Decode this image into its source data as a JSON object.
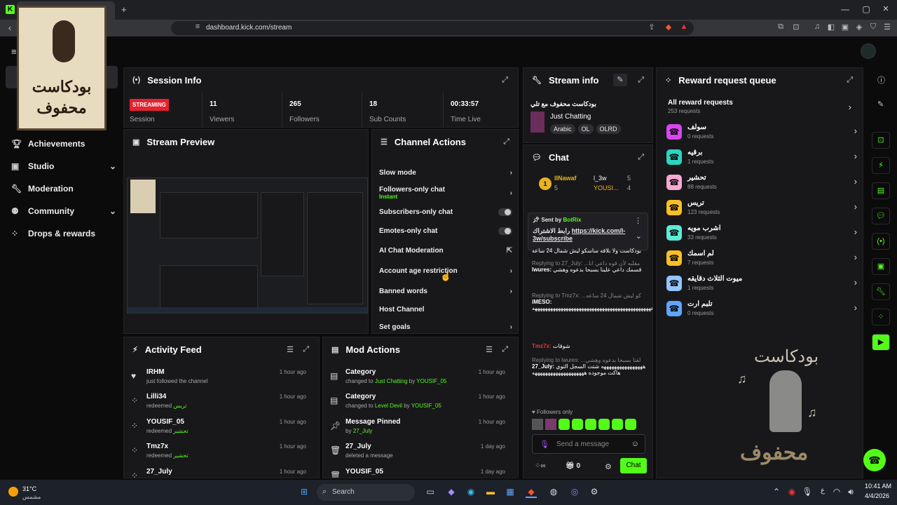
{
  "browser": {
    "url": "dashboard.kick.com/stream",
    "tab_close": "×",
    "tab_add": "+"
  },
  "logo": {
    "line1": "بودكاست",
    "line2": "محفوف"
  },
  "nav": [
    {
      "label": "Achievements",
      "icon": "trophy-icon"
    },
    {
      "label": "Studio",
      "icon": "studio-icon"
    },
    {
      "label": "Moderation",
      "icon": "wrench-icon"
    },
    {
      "label": "Community",
      "icon": "community-icon"
    },
    {
      "label": "Drops & rewards",
      "icon": "drops-icon"
    }
  ],
  "session": {
    "title": "Session Info",
    "stats": [
      {
        "value": "STREAMING",
        "label": "Session"
      },
      {
        "value": "11",
        "label": "Viewers"
      },
      {
        "value": "265",
        "label": "Followers"
      },
      {
        "value": "18",
        "label": "Sub Counts"
      },
      {
        "value": "00:33:57",
        "label": "Time Live"
      }
    ]
  },
  "preview": {
    "title": "Stream Preview"
  },
  "channel_actions": {
    "title": "Channel Actions",
    "items": [
      {
        "label": "Slow mode",
        "sub": ""
      },
      {
        "label": "Followers-only chat",
        "sub": "Instant"
      },
      {
        "label": "Subscribers-only chat",
        "sub": ""
      },
      {
        "label": "Emotes-only chat",
        "sub": ""
      },
      {
        "label": "AI Chat Moderation",
        "sub": ""
      },
      {
        "label": "Account age restriction",
        "sub": ""
      },
      {
        "label": "Banned words",
        "sub": ""
      },
      {
        "label": "Host Channel",
        "sub": ""
      },
      {
        "label": "Set goals",
        "sub": ""
      }
    ]
  },
  "stream_info": {
    "title": "Stream info",
    "name": "بودكاست محفوف مع تلي",
    "category": "Just Chatting",
    "tags": [
      "Arabic",
      "OL",
      "OLRD"
    ]
  },
  "chat": {
    "title": "Chat",
    "top": [
      {
        "name": "llNawaf",
        "count": "5",
        "rank": "1"
      },
      {
        "name": "l_3w",
        "count": "5"
      },
      {
        "name": "YOUSI...",
        "count": "4"
      }
    ],
    "pinned_by_label": "Sent by",
    "pinned_by": "BotRix",
    "pinned_text": "رابط الاشتراك",
    "pinned_link": "https://kick.com/l-3w/subscribe",
    "lines": [
      {
        "reply": "",
        "user": "",
        "text": "بودكاست ولا بلاقه ساسكو ليش شمال 24 ساعه"
      },
      {
        "reply": "Replying to 27_July: ...مقلبه لأن قوه داعي انا",
        "user": "lwures:",
        "text": "قسمك داعي علينا بسبحا بدعوه وهشي"
      },
      {
        "reply": "Replying to Tmz7x: ...كو ليش شمال 24 ساعه",
        "user": "iMESO:",
        "text": "ههههههههههههههههههههههههههههههههههههههههههههههه"
      },
      {
        "reply": "",
        "user": "Tmz7x:",
        "text": "شوقات"
      },
      {
        "reply": "Replying to lwures: ...لقتا بسبحا بدعوه وهشي",
        "user": "27_July:",
        "text": "ههههههههههههههههه شتت السجل الثوي هاكت موجوده ههههههههههههههههههههه"
      }
    ],
    "followers_only": "Followers only",
    "placeholder": "Send a message",
    "footer_count": "0",
    "send_label": "Chat"
  },
  "reward_queue": {
    "title": "Reward request queue",
    "all_label": "All reward requests",
    "all_count": "253 requests",
    "items": [
      {
        "name": "سولف",
        "count": "0 requests",
        "color": "#d946ef"
      },
      {
        "name": "برقيه",
        "count": "1 requests",
        "color": "#2dd4bf"
      },
      {
        "name": "تحشير",
        "count": "88 requests",
        "color": "#f9a8d4"
      },
      {
        "name": "تريس",
        "count": "123 requests",
        "color": "#fbbf24"
      },
      {
        "name": "اشرب مويه",
        "count": "33 requests",
        "color": "#5eead4"
      },
      {
        "name": "لم اسمك",
        "count": "7 requests",
        "color": "#fbbf24"
      },
      {
        "name": "ميوت الثلاث دقايقه",
        "count": "1 requests",
        "color": "#93c5fd"
      },
      {
        "name": "تلبم ارت",
        "count": "0 requests",
        "color": "#60a5fa"
      }
    ]
  },
  "activity": {
    "title": "Activity Feed",
    "rows": [
      {
        "name": "IRHM",
        "desc": "just followed the channel",
        "item": "",
        "time": "1 hour ago",
        "icon": "heart-icon"
      },
      {
        "name": "Lilli34",
        "desc": "redeemed",
        "item": "تريس",
        "time": "1 hour ago",
        "icon": "drops-icon"
      },
      {
        "name": "YOUSIF_05",
        "desc": "redeemed",
        "item": "تحشير",
        "time": "1 hour ago",
        "icon": "drops-icon"
      },
      {
        "name": "Tmz7x",
        "desc": "redeemed",
        "item": "تحشير",
        "time": "1 hour ago",
        "icon": "drops-icon"
      },
      {
        "name": "27_July",
        "desc": "",
        "item": "",
        "time": "1 hour ago",
        "icon": "drops-icon"
      }
    ]
  },
  "mod": {
    "title": "Mod Actions",
    "rows": [
      {
        "name": "Category",
        "pre": "changed to",
        "item": "Just Chatting",
        "by": "YOUSIF_05",
        "time": "1 hour ago",
        "icon": "category-icon"
      },
      {
        "name": "Category",
        "pre": "changed to",
        "item": "Level Devil",
        "by": "YOUSIF_05",
        "time": "1 hour ago",
        "icon": "category-icon"
      },
      {
        "name": "Message Pinned",
        "pre": "by",
        "item": "27_July",
        "by": "",
        "time": "1 hour ago",
        "icon": "pin-icon"
      },
      {
        "name": "27_July",
        "pre": "deleted a message",
        "item": "",
        "by": "",
        "time": "1 day ago",
        "icon": "trash-icon"
      },
      {
        "name": "YOUSIF_05",
        "pre": "",
        "item": "",
        "by": "",
        "time": "1 day ago",
        "icon": "trash-icon"
      }
    ]
  },
  "overlay": {
    "top": "بودكاست",
    "bottom": "محفوف"
  },
  "taskbar": {
    "weather_temp": "31°C",
    "weather_desc": "مشمس",
    "search": "Search",
    "time": "10:41 AM",
    "date": "4/4/2026",
    "lang": "ع"
  }
}
